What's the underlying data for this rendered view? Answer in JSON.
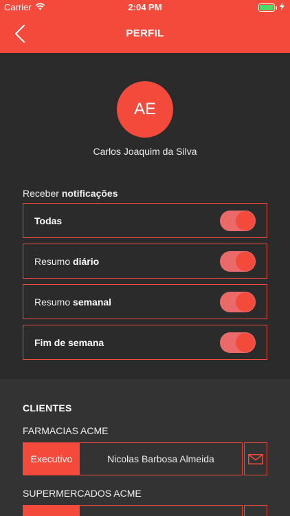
{
  "status_bar": {
    "carrier": "Carrier",
    "time": "2:04 PM"
  },
  "header": {
    "title": "PERFIL",
    "back_icon": "chevron-left-icon"
  },
  "profile": {
    "initials": "AE",
    "name": "Carlos Joaquim da Silva"
  },
  "notifications": {
    "heading_prefix": "Receber",
    "heading_bold": "notificações",
    "options": [
      {
        "prefix": "",
        "bold": "Todas",
        "enabled": true
      },
      {
        "prefix": "Resumo",
        "bold": "diário",
        "enabled": true
      },
      {
        "prefix": "Resumo",
        "bold": "semanal",
        "enabled": true
      },
      {
        "prefix": "",
        "bold": "Fim de semana",
        "enabled": true
      }
    ]
  },
  "clients": {
    "title": "CLIENTES",
    "items": [
      {
        "name": "FARMACIAS ACME",
        "role_label": "Executivo",
        "executive": "Nicolas Barbosa Almeida",
        "action_icon": "mail-icon"
      },
      {
        "name": "SUPERMERCADOS ACME",
        "role_label": "",
        "executive": "",
        "action_icon": "mail-icon"
      }
    ]
  },
  "colors": {
    "accent": "#f44a3c",
    "background": "#2b2b2b",
    "section_background": "#333333",
    "switch_track": "#ea6a6a",
    "battery": "#4cd964"
  }
}
